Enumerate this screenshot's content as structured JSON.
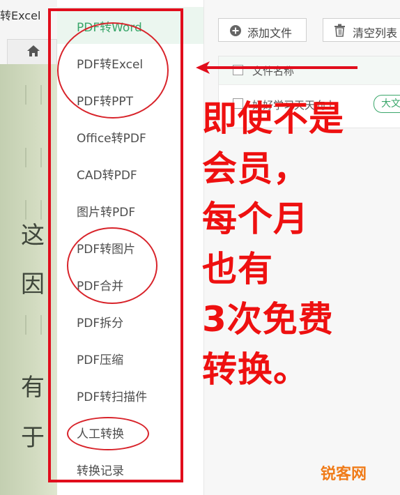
{
  "window": {
    "title": "转Excel"
  },
  "sidebar": {
    "items": [
      {
        "label": "PDF转Word",
        "active": true
      },
      {
        "label": "PDF转Excel"
      },
      {
        "label": "PDF转PPT"
      },
      {
        "label": "Office转PDF"
      },
      {
        "label": "CAD转PDF"
      },
      {
        "label": "图片转PDF"
      },
      {
        "label": "PDF转图片"
      },
      {
        "label": "PDF合并"
      },
      {
        "label": "PDF拆分"
      },
      {
        "label": "PDF压缩"
      },
      {
        "label": "PDF转扫描件"
      },
      {
        "label": "人工转换"
      },
      {
        "label": "转换记录"
      }
    ]
  },
  "toolbar": {
    "add_label": "添加文件",
    "clear_label": "清空列表"
  },
  "file_list": {
    "header": "文件名称",
    "rows": [
      {
        "name": "好好学习天天向上",
        "tag": "大文"
      }
    ]
  },
  "background_doc": {
    "lines": [
      "这",
      "因",
      "有",
      "于"
    ]
  },
  "annotation": {
    "text_lines": [
      "即使不是",
      "会员，",
      "每个月",
      "也有",
      "3次免费",
      "转换。"
    ],
    "color": "#ee1010"
  },
  "watermark": "锐客网",
  "colors": {
    "accent": "#3aa66a",
    "annotation_red": "#e10d1c",
    "watermark": "#f07b18"
  },
  "icons": [
    "home-icon",
    "add-circle-icon",
    "trash-icon",
    "arrow-left-icon"
  ]
}
